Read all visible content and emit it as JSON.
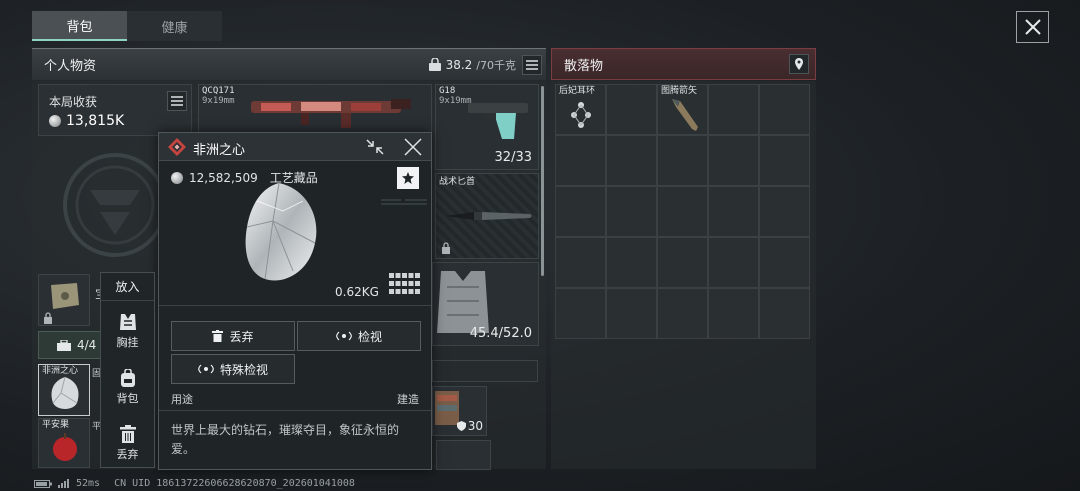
{
  "tabs": [
    {
      "label": "背包",
      "active": true
    },
    {
      "label": "健康",
      "active": false
    }
  ],
  "personal": {
    "title": "个人物资",
    "weight_current": "38.2",
    "weight_max": "/70千克"
  },
  "earnings": {
    "label": "本局收获",
    "value": "13,815K"
  },
  "slots": {
    "primary": {
      "name": "QCQ171",
      "caliber": "9x19mm"
    },
    "sidearm": {
      "name": "G18",
      "caliber": "9x19mm",
      "ammo": "32/33"
    },
    "melee": {
      "name": "战术匕首"
    },
    "armor": {
      "durability": "45.4/52.0"
    },
    "small_item_prefix": "宝",
    "container_count": "4/4",
    "backpack_count": "30",
    "item_a": "非洲之心",
    "item_b": "平安果",
    "item_c_prefix": "固",
    "item_d_prefix": "平"
  },
  "loot": {
    "title": "散落物",
    "items": [
      {
        "name": "后妃耳环"
      },
      {
        "name": "图腾箭矢"
      }
    ]
  },
  "card": {
    "title": "非洲之心",
    "price": "12,582,509",
    "category": "工艺藏品",
    "weight": "0.62KG",
    "btn_discard": "丢弃",
    "btn_inspect": "检视",
    "btn_special": "特殊检视",
    "use_label": "用途",
    "build_label": "建造",
    "description": "世界上最大的钻石，璀璨夺目，象征永恒的爱。"
  },
  "putin": {
    "title": "放入",
    "items": [
      {
        "label": "胸挂",
        "icon": "vest-icon"
      },
      {
        "label": "背包",
        "icon": "backpack-icon"
      },
      {
        "label": "丢弃",
        "icon": "trash-icon"
      }
    ]
  },
  "footer": {
    "ping": "52ms",
    "uid": "CN UID 18613722606628620870_202601041008"
  }
}
